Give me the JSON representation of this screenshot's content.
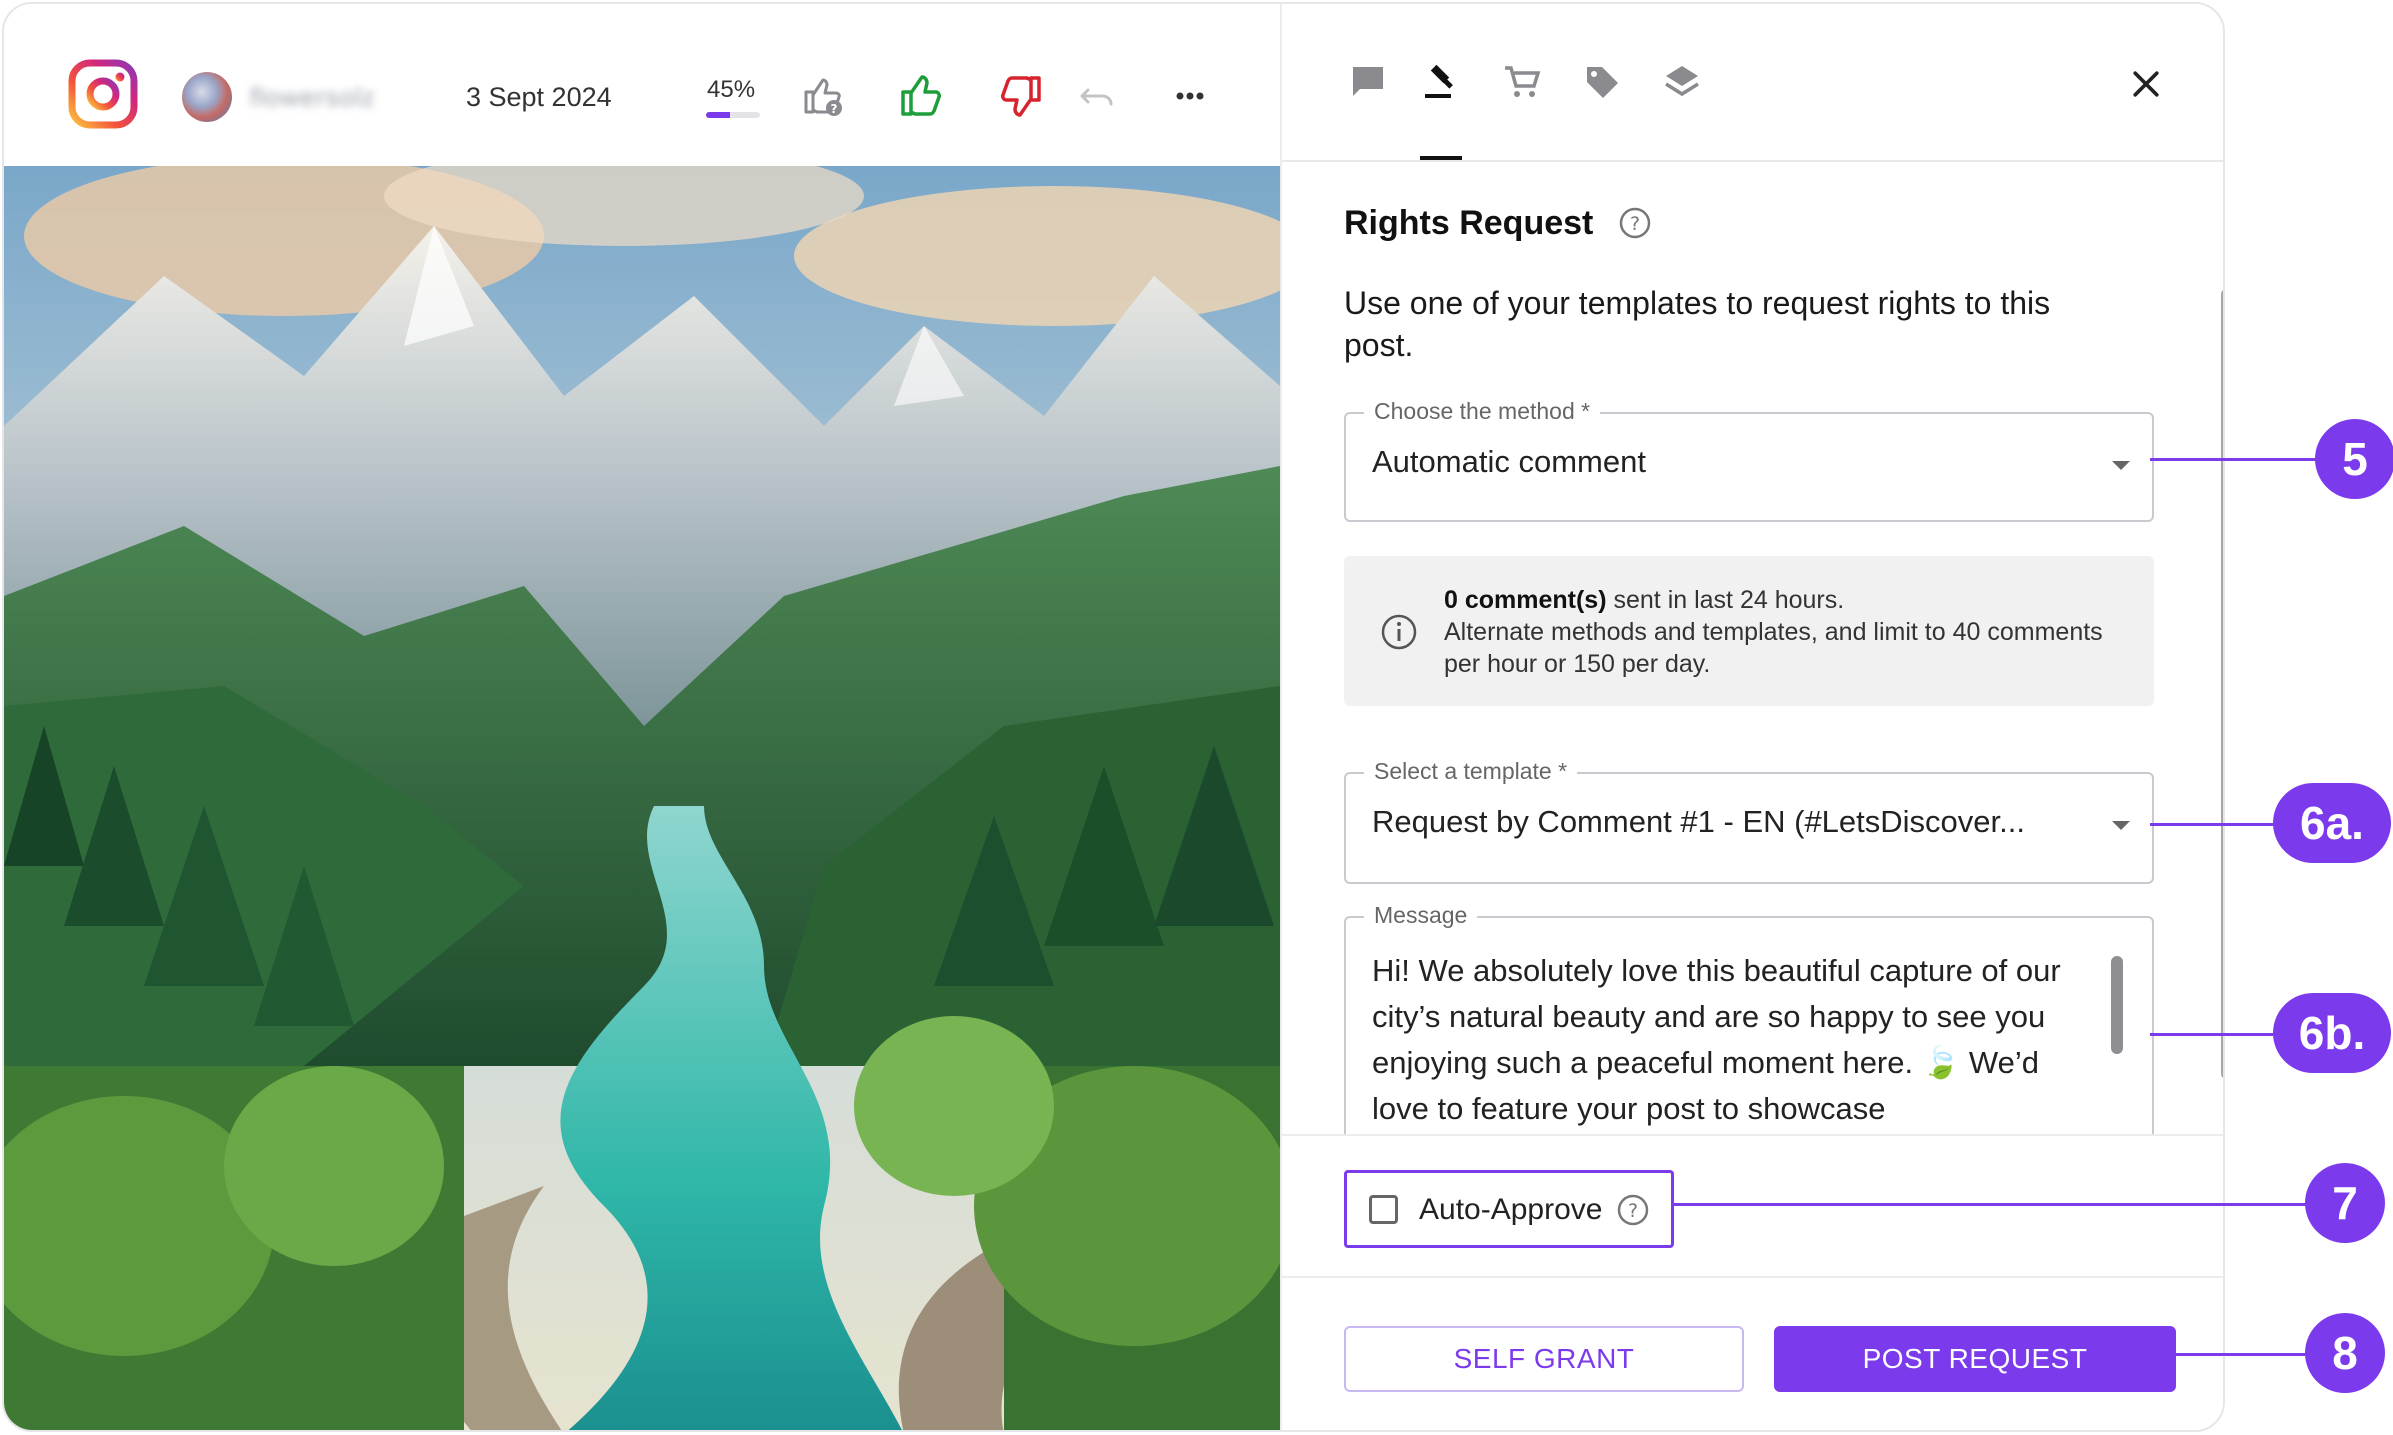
{
  "post": {
    "username": "flowersolz",
    "date": "3 Sept 2024",
    "score": {
      "label": "45%",
      "value": 0.45
    }
  },
  "header_icons": [
    "instagram-icon",
    "like-pending-icon",
    "thumbs-up-icon",
    "thumbs-down-icon",
    "undo-icon",
    "more-icon"
  ],
  "panel": {
    "tabs": [
      "comments-icon",
      "gavel-icon",
      "cart-icon",
      "tag-icon",
      "layers-icon"
    ],
    "active_tab": "gavel-icon",
    "title": "Rights Request",
    "intro": "Use one of your templates to request rights to this post.",
    "method": {
      "label": "Choose the method",
      "required": "*",
      "value": "Automatic comment"
    },
    "info": {
      "bold": "0 comment(s)",
      "line1_rest": " sent in last 24 hours.",
      "line2": "Alternate methods and templates, and limit to 40 comments per hour or 150 per day."
    },
    "template": {
      "label": "Select a template",
      "required": "*",
      "value": "Request by Comment #1 - EN (#LetsDiscover..."
    },
    "message": {
      "label": "Message",
      "text": "Hi! We absolutely love this beautiful capture of our city’s natural beauty and are so happy to see you enjoying such a peaceful moment here. 🍃 We’d love to feature your post to showcase"
    },
    "auto_approve": {
      "label": "Auto-Approve",
      "checked": false
    },
    "buttons": {
      "self_grant": "SELF GRANT",
      "post_request": "POST REQUEST"
    }
  },
  "callouts": [
    "5",
    "6a.",
    "6b.",
    "7",
    "8"
  ],
  "colors": {
    "accent": "#7c3aed",
    "like": "#1e9e3a",
    "dislike": "#d8232f"
  }
}
